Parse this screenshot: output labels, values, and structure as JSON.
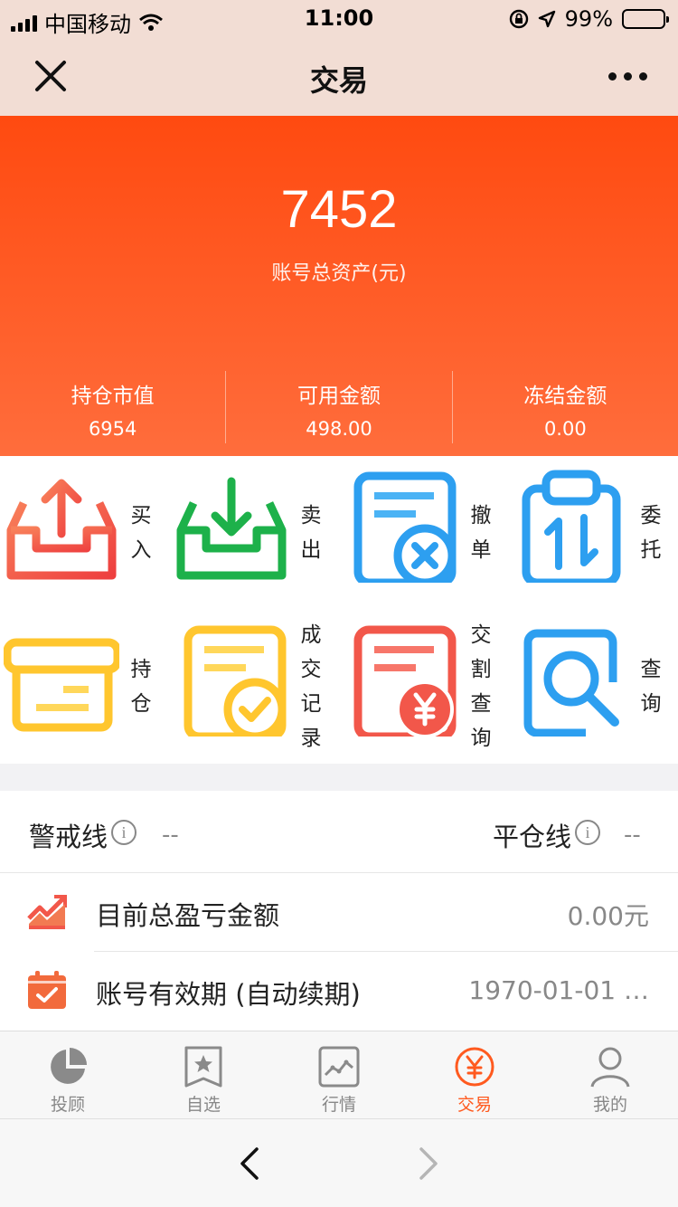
{
  "status_bar": {
    "carrier": "中国移动",
    "time": "11:00",
    "battery": "99%"
  },
  "nav": {
    "title": "交易"
  },
  "summary": {
    "total_assets": "7452",
    "total_label": "账号总资产(元)",
    "stats": [
      {
        "label": "持仓市值",
        "value": "6954"
      },
      {
        "label": "可用金额",
        "value": "498.00"
      },
      {
        "label": "冻结金额",
        "value": "0.00"
      }
    ]
  },
  "actions": [
    {
      "label": "买入",
      "chars": [
        "买",
        "入"
      ],
      "icon": "buy-tray-icon"
    },
    {
      "label": "卖出",
      "chars": [
        "卖",
        "出"
      ],
      "icon": "sell-tray-icon"
    },
    {
      "label": "撤单",
      "chars": [
        "撤",
        "单"
      ],
      "icon": "cancel-order-icon"
    },
    {
      "label": "委托",
      "chars": [
        "委",
        "托"
      ],
      "icon": "entrust-icon"
    },
    {
      "label": "持仓",
      "chars": [
        "持",
        "仓"
      ],
      "icon": "holdings-box-icon"
    },
    {
      "label": "成交记录",
      "chars": [
        "成",
        "交",
        "记",
        "录"
      ],
      "icon": "deal-record-icon"
    },
    {
      "label": "交割查询",
      "chars": [
        "交",
        "割",
        "查",
        "询"
      ],
      "icon": "settlement-query-icon"
    },
    {
      "label": "查询",
      "chars": [
        "查",
        "询"
      ],
      "icon": "search-query-icon"
    }
  ],
  "lines": {
    "warning_label": "警戒线",
    "warning_value": "--",
    "liquidation_label": "平仓线",
    "liquidation_value": "--"
  },
  "rows": [
    {
      "label": "目前总盈亏金额",
      "value": "0.00元",
      "icon": "trend-chart-icon"
    },
    {
      "label": "账号有效期 (自动续期)",
      "value": "1970-01-01 …",
      "icon": "calendar-check-icon"
    }
  ],
  "tabs": [
    {
      "label": "投顾",
      "icon": "pie-chart-icon",
      "active": false
    },
    {
      "label": "自选",
      "icon": "bookmark-star-icon",
      "active": false
    },
    {
      "label": "行情",
      "icon": "market-line-icon",
      "active": false
    },
    {
      "label": "交易",
      "icon": "yen-circle-icon",
      "active": true
    },
    {
      "label": "我的",
      "icon": "user-icon",
      "active": false
    }
  ],
  "colors": {
    "accent": "#ff5a1f",
    "hero_top": "#ff4a10",
    "hero_bottom": "#ff6d3c",
    "buy": "#f2574a",
    "sell": "#1db14a",
    "blue": "#2d9ff0",
    "yellow": "#ffc62e"
  }
}
